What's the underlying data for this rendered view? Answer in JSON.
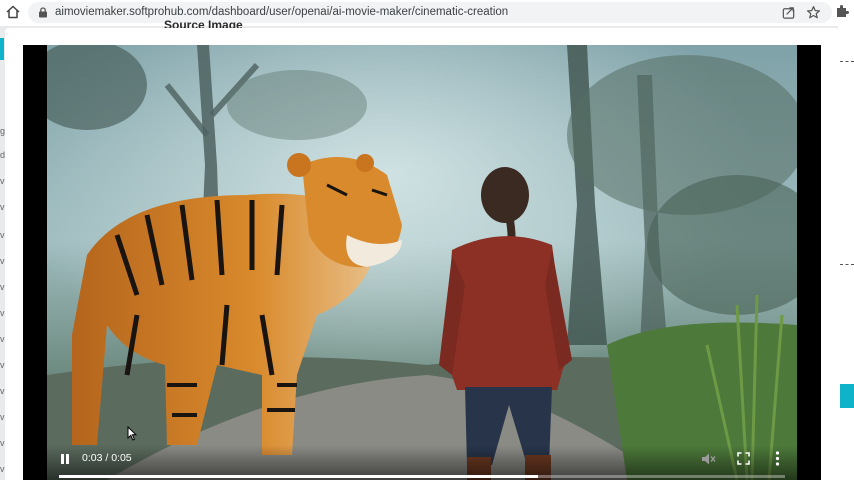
{
  "browser": {
    "url": "aimoviemaker.softprohub.com/dashboard/user/openai/ai-movie-maker/cinematic-creation"
  },
  "page": {
    "heading": "Source Image",
    "left_nav_letters": [
      "g",
      "d",
      "vi",
      "vi",
      "vi",
      "vi",
      "vi",
      "vi",
      "vi",
      "vi",
      "vi",
      "vi",
      "vi",
      "vi"
    ]
  },
  "video": {
    "current_time": "0:03",
    "duration": "0:05",
    "time_display": "0:03 / 0:05",
    "progress": 0.66,
    "state": "playing"
  },
  "icons": {
    "home": "home-icon",
    "lock": "lock-icon",
    "share": "share-icon",
    "bookmark": "star-icon",
    "extensions": "puzzle-icon",
    "pause": "pause-icon",
    "volume": "volume-muted-icon",
    "fullscreen": "fullscreen-icon",
    "more": "more-vertical-icon"
  },
  "colors": {
    "accent": "#0fb3c9",
    "jacket": "#8c2f24",
    "tiger": "#c9741f"
  }
}
